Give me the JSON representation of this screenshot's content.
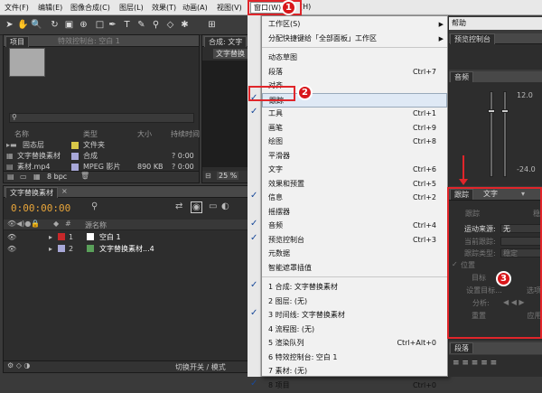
{
  "menubar": {
    "file": "文件(F)",
    "edit": "编辑(E)",
    "composition": "图像合成(C)",
    "layer": "图层(L)",
    "effect": "效果(T)",
    "animation": "动画(A)",
    "view": "视图(V)",
    "window": "窗口(W)",
    "help": "(H)"
  },
  "window_menu": {
    "items": [
      {
        "label": "工作区(S)",
        "shortcut": "",
        "checked": false,
        "submenu": true
      },
      {
        "label": "分配快捷键给「全部面板」工作区",
        "shortcut": "",
        "checked": false,
        "submenu": true
      },
      {
        "sep": true
      },
      {
        "label": "动态草图",
        "shortcut": "",
        "checked": false
      },
      {
        "label": "段落",
        "shortcut": "Ctrl+7",
        "checked": false
      },
      {
        "label": "对齐",
        "shortcut": "",
        "checked": false
      },
      {
        "label": "跟踪",
        "shortcut": "",
        "checked": true
      },
      {
        "label": "工具",
        "shortcut": "Ctrl+1",
        "checked": true
      },
      {
        "label": "画笔",
        "shortcut": "Ctrl+9",
        "checked": false
      },
      {
        "label": "绘图",
        "shortcut": "Ctrl+8",
        "checked": false
      },
      {
        "label": "平滑器",
        "shortcut": "",
        "checked": false
      },
      {
        "label": "文字",
        "shortcut": "Ctrl+6",
        "checked": false
      },
      {
        "label": "效果和预置",
        "shortcut": "Ctrl+5",
        "checked": false
      },
      {
        "label": "信息",
        "shortcut": "Ctrl+2",
        "checked": true
      },
      {
        "label": "摇摆器",
        "shortcut": "",
        "checked": false
      },
      {
        "label": "音频",
        "shortcut": "Ctrl+4",
        "checked": true
      },
      {
        "label": "预览控制台",
        "shortcut": "Ctrl+3",
        "checked": true
      },
      {
        "label": "元数据",
        "shortcut": "",
        "checked": false
      },
      {
        "label": "智能遮罩插值",
        "shortcut": "",
        "checked": false
      },
      {
        "sep": true
      },
      {
        "label": "1 合成: 文字替换素材",
        "shortcut": "",
        "checked": true
      },
      {
        "label": "2 图层: (无)",
        "shortcut": "",
        "checked": false
      },
      {
        "label": "3 时间线: 文字替换素材",
        "shortcut": "",
        "checked": true
      },
      {
        "label": "4 流程图: (无)",
        "shortcut": "",
        "checked": false
      },
      {
        "label": "5 渲染队列",
        "shortcut": "Ctrl+Alt+0",
        "checked": false
      },
      {
        "label": "6 特效控制台: 空白 1",
        "shortcut": "",
        "checked": false
      },
      {
        "label": "7 素材: (无)",
        "shortcut": "",
        "checked": false
      },
      {
        "label": "8 项目",
        "shortcut": "Ctrl+0",
        "checked": true
      }
    ]
  },
  "project_panel": {
    "tab": "项目",
    "effects_tab": "特效控制台: 空白 1",
    "headers": {
      "name": "名称",
      "type": "类型",
      "size": "大小",
      "duration": "持续时间"
    },
    "rows": [
      {
        "name": "固态层",
        "type": "文件夹",
        "size": "",
        "duration": ""
      },
      {
        "name": "文字替换素材",
        "type": "合成",
        "size": "",
        "duration": "? 0:00"
      },
      {
        "name": "素材.mp4",
        "type": "MPEG 影片",
        "size": "890 KB",
        "duration": "? 0:00"
      }
    ],
    "bpc": "8 bpc"
  },
  "comp_panel": {
    "tab": "合成: 文字",
    "label": "文字替换",
    "zoom": "25 %"
  },
  "timeline": {
    "tab": "文字替换素材",
    "timecode": "0:00:00:00",
    "source_header": "源名称",
    "layers": [
      {
        "num": "1",
        "name": "空白 1",
        "color": "#c8282a"
      },
      {
        "num": "2",
        "name": "文字替换素材...4",
        "color": "#5aa05a"
      }
    ],
    "toggle_label": "切换开关 / 模式"
  },
  "right_panel": {
    "help": "帮助",
    "preview_tab": "预览控制台",
    "audio_tab": "音频",
    "db_labels": [
      "12.0",
      "-24.0"
    ],
    "tracker_tab": "跟踪",
    "text_tab": "文字",
    "track_btn": "跟踪",
    "stabilize_btn": "稳",
    "motion_source_label": "运动来源:",
    "motion_source_value": "无",
    "current_track_label": "当前跟踪:",
    "track_type_label": "跟踪类型:",
    "track_type_value": "稳定",
    "position_label": "位置",
    "target_label": "目标",
    "edit_target_btn": "设置目标...",
    "select_btn": "选项",
    "analyze_label": "分析:",
    "reset_btn": "重置",
    "apply_btn": "应用",
    "paragraph_tab": "段落"
  },
  "badges": [
    "1",
    "2",
    "3"
  ],
  "colors": {
    "accent_red": "#e0252a",
    "menu_bg": "#f1f1f1",
    "panel_bg": "#2d2d2d",
    "timecode": "#e8a53a"
  }
}
